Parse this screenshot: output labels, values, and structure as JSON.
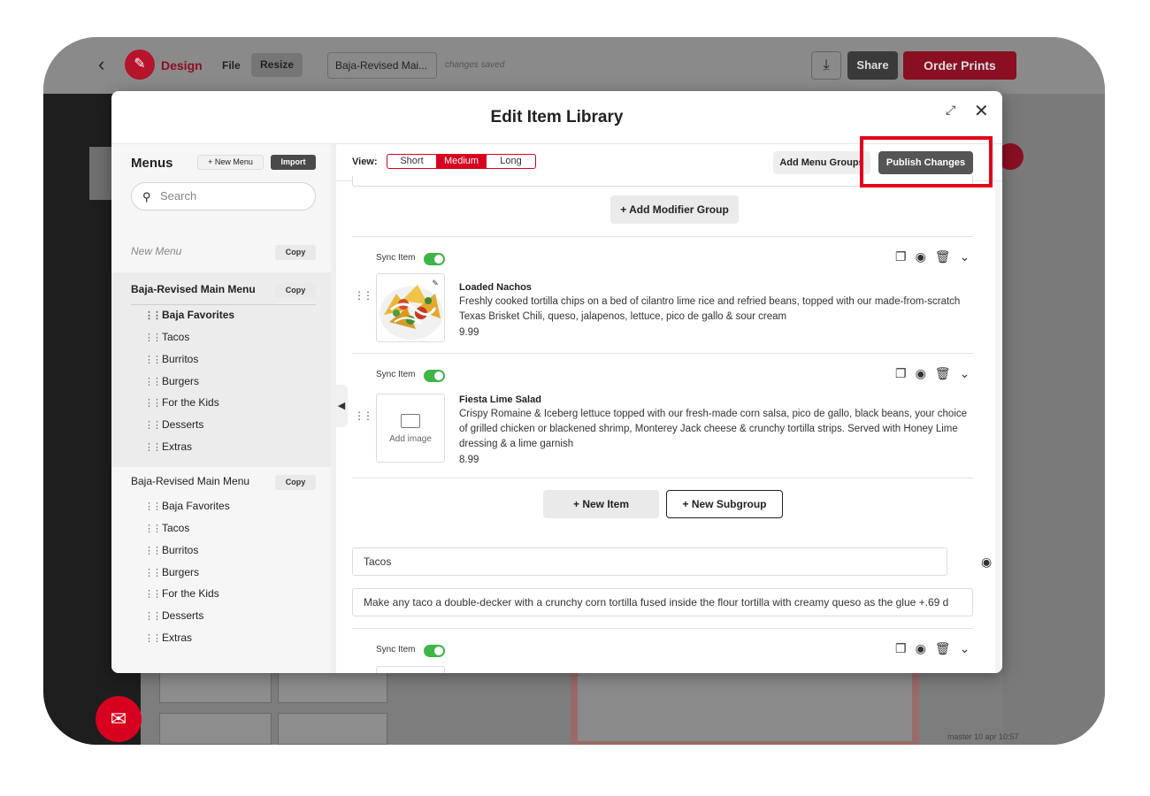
{
  "app": {
    "brand": "Design",
    "file_label": "File",
    "resize_label": "Resize",
    "doc_name": "Baja-Revised Mai...",
    "saved_status": "changes saved",
    "share_label": "Share",
    "order_label": "Order Prints",
    "master_label": "master 10 apr 10:57"
  },
  "modal": {
    "title": "Edit Item Library"
  },
  "sidebar": {
    "title": "Menus",
    "new_menu_button": "+ New Menu",
    "import_button": "Import",
    "search_placeholder": "Search",
    "new_menu_row": "New Menu",
    "copy_label": "Copy",
    "menus": [
      {
        "name": "Baja-Revised Main Menu",
        "groups": [
          "Baja Favorites",
          "Tacos",
          "Burritos",
          "Burgers",
          "For the Kids",
          "Desserts",
          "Extras"
        ]
      },
      {
        "name": "Baja-Revised Main Menu",
        "groups": [
          "Baja Favorites",
          "Tacos",
          "Burritos",
          "Burgers",
          "For the Kids",
          "Desserts",
          "Extras"
        ]
      }
    ]
  },
  "main": {
    "view_label": "View:",
    "views": [
      "Short",
      "Medium",
      "Long"
    ],
    "active_view": "Medium",
    "add_groups_button": "Add Menu Groups",
    "publish_button": "Publish Changes",
    "add_modifier_button": "+ Add Modifier Group",
    "sync_label": "Sync Item",
    "items": [
      {
        "name": "Loaded Nachos",
        "description": "Freshly cooked tortilla chips on a bed of cilantro lime rice and refried beans, topped with our made-from-scratch Texas Brisket Chili, queso, jalapenos, lettuce, pico de gallo & sour cream",
        "price": "9.99"
      },
      {
        "name": "Fiesta Lime Salad",
        "description": "Crispy Romaine & Iceberg lettuce topped with our fresh-made corn salsa, pico de gallo, black beans, your choice of grilled chicken or blackened shrimp, Monterey Jack cheese & crunchy tortilla strips. Served with Honey Lime dressing & a lime garnish",
        "price": "8.99"
      }
    ],
    "add_image_label": "Add image",
    "new_item_button": "+ New Item",
    "new_subgroup_button": "+ New Subgroup",
    "group_name_value": "Tacos",
    "group_desc_value": "Make any taco a double-decker with a crunchy corn tortilla fused inside the flour tortilla with creamy queso as the glue +.69 d"
  },
  "colors": {
    "accent": "#d8001f",
    "toggle_on": "#3fb548"
  }
}
